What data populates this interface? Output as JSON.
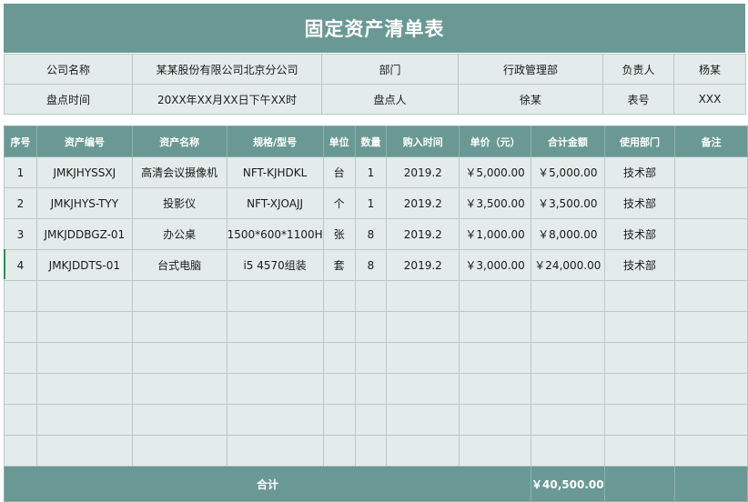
{
  "title": "固定资产清单表",
  "info": {
    "row1": [
      {
        "label": "公司名称",
        "value": "某某股份有限公司北京分公司"
      },
      {
        "label": "部门",
        "value": "行政管理部"
      },
      {
        "label": "负责人",
        "value": "杨某"
      }
    ],
    "row2": [
      {
        "label": "盘点时间",
        "value": "20XX年XX月XX日下午XX时"
      },
      {
        "label": "盘点人",
        "value": "徐某"
      },
      {
        "label": "表号",
        "value": "XXX"
      }
    ]
  },
  "table": {
    "headers": [
      "序号",
      "资产编号",
      "资产名称",
      "规格/型号",
      "单位",
      "数量",
      "购入时间",
      "单价（元）",
      "合计金额",
      "使用部门",
      "备注"
    ],
    "rows": [
      [
        "1",
        "JMKJHYSSXJ",
        "高清会议摄像机",
        "NFT-KJHDKL",
        "台",
        "1",
        "2019.2",
        "￥5,000.00",
        "￥5,000.00",
        "技术部",
        ""
      ],
      [
        "2",
        "JMKJHYS-TYY",
        "投影仪",
        "NFT-XJOAJJ",
        "个",
        "1",
        "2019.2",
        "￥3,500.00",
        "￥3,500.00",
        "技术部",
        ""
      ],
      [
        "3",
        "JMKJDDBGZ-01",
        "办公桌",
        "1500*600*1100H",
        "张",
        "8",
        "2019.2",
        "￥1,000.00",
        "￥8,000.00",
        "技术部",
        ""
      ],
      [
        "4",
        "JMKJDDTS-01",
        "台式电脑",
        "i5 4570组装",
        "套",
        "8",
        "2019.2",
        "￥3,000.00",
        "￥24,000.00",
        "技术部",
        ""
      ],
      [
        "",
        "",
        "",
        "",
        "",
        "",
        "",
        "",
        "",
        "",
        ""
      ],
      [
        "",
        "",
        "",
        "",
        "",
        "",
        "",
        "",
        "",
        "",
        ""
      ],
      [
        "",
        "",
        "",
        "",
        "",
        "",
        "",
        "",
        "",
        "",
        ""
      ],
      [
        "",
        "",
        "",
        "",
        "",
        "",
        "",
        "",
        "",
        "",
        ""
      ],
      [
        "",
        "",
        "",
        "",
        "",
        "",
        "",
        "",
        "",
        "",
        ""
      ],
      [
        "",
        "",
        "",
        "",
        "",
        "",
        "",
        "",
        "",
        "",
        ""
      ]
    ],
    "total_label": "合计",
    "total_value": "￥40,500.00"
  },
  "colors": {
    "header": "#6a9995",
    "cell": "#e3ecea",
    "border": "#b9c8c6"
  }
}
